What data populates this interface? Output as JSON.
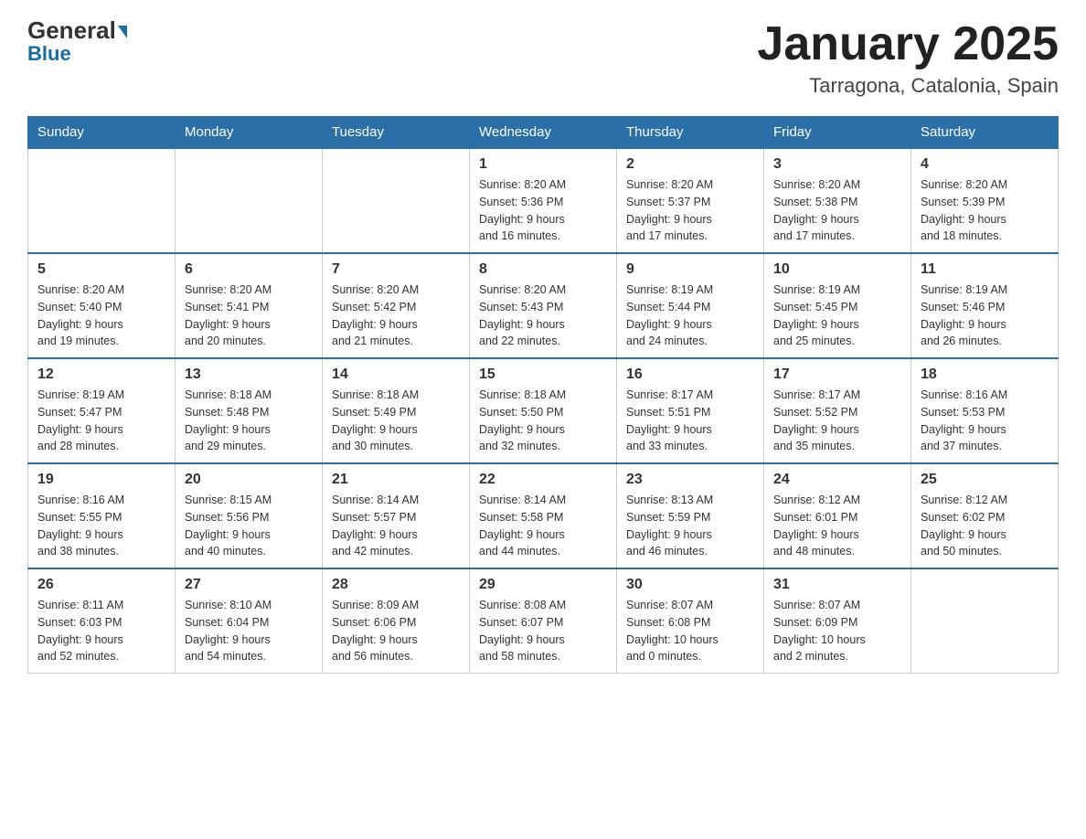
{
  "header": {
    "logo_general": "General",
    "logo_blue": "Blue",
    "month_title": "January 2025",
    "location": "Tarragona, Catalonia, Spain"
  },
  "days_of_week": [
    "Sunday",
    "Monday",
    "Tuesday",
    "Wednesday",
    "Thursday",
    "Friday",
    "Saturday"
  ],
  "weeks": [
    [
      {
        "day": "",
        "info": ""
      },
      {
        "day": "",
        "info": ""
      },
      {
        "day": "",
        "info": ""
      },
      {
        "day": "1",
        "info": "Sunrise: 8:20 AM\nSunset: 5:36 PM\nDaylight: 9 hours\nand 16 minutes."
      },
      {
        "day": "2",
        "info": "Sunrise: 8:20 AM\nSunset: 5:37 PM\nDaylight: 9 hours\nand 17 minutes."
      },
      {
        "day": "3",
        "info": "Sunrise: 8:20 AM\nSunset: 5:38 PM\nDaylight: 9 hours\nand 17 minutes."
      },
      {
        "day": "4",
        "info": "Sunrise: 8:20 AM\nSunset: 5:39 PM\nDaylight: 9 hours\nand 18 minutes."
      }
    ],
    [
      {
        "day": "5",
        "info": "Sunrise: 8:20 AM\nSunset: 5:40 PM\nDaylight: 9 hours\nand 19 minutes."
      },
      {
        "day": "6",
        "info": "Sunrise: 8:20 AM\nSunset: 5:41 PM\nDaylight: 9 hours\nand 20 minutes."
      },
      {
        "day": "7",
        "info": "Sunrise: 8:20 AM\nSunset: 5:42 PM\nDaylight: 9 hours\nand 21 minutes."
      },
      {
        "day": "8",
        "info": "Sunrise: 8:20 AM\nSunset: 5:43 PM\nDaylight: 9 hours\nand 22 minutes."
      },
      {
        "day": "9",
        "info": "Sunrise: 8:19 AM\nSunset: 5:44 PM\nDaylight: 9 hours\nand 24 minutes."
      },
      {
        "day": "10",
        "info": "Sunrise: 8:19 AM\nSunset: 5:45 PM\nDaylight: 9 hours\nand 25 minutes."
      },
      {
        "day": "11",
        "info": "Sunrise: 8:19 AM\nSunset: 5:46 PM\nDaylight: 9 hours\nand 26 minutes."
      }
    ],
    [
      {
        "day": "12",
        "info": "Sunrise: 8:19 AM\nSunset: 5:47 PM\nDaylight: 9 hours\nand 28 minutes."
      },
      {
        "day": "13",
        "info": "Sunrise: 8:18 AM\nSunset: 5:48 PM\nDaylight: 9 hours\nand 29 minutes."
      },
      {
        "day": "14",
        "info": "Sunrise: 8:18 AM\nSunset: 5:49 PM\nDaylight: 9 hours\nand 30 minutes."
      },
      {
        "day": "15",
        "info": "Sunrise: 8:18 AM\nSunset: 5:50 PM\nDaylight: 9 hours\nand 32 minutes."
      },
      {
        "day": "16",
        "info": "Sunrise: 8:17 AM\nSunset: 5:51 PM\nDaylight: 9 hours\nand 33 minutes."
      },
      {
        "day": "17",
        "info": "Sunrise: 8:17 AM\nSunset: 5:52 PM\nDaylight: 9 hours\nand 35 minutes."
      },
      {
        "day": "18",
        "info": "Sunrise: 8:16 AM\nSunset: 5:53 PM\nDaylight: 9 hours\nand 37 minutes."
      }
    ],
    [
      {
        "day": "19",
        "info": "Sunrise: 8:16 AM\nSunset: 5:55 PM\nDaylight: 9 hours\nand 38 minutes."
      },
      {
        "day": "20",
        "info": "Sunrise: 8:15 AM\nSunset: 5:56 PM\nDaylight: 9 hours\nand 40 minutes."
      },
      {
        "day": "21",
        "info": "Sunrise: 8:14 AM\nSunset: 5:57 PM\nDaylight: 9 hours\nand 42 minutes."
      },
      {
        "day": "22",
        "info": "Sunrise: 8:14 AM\nSunset: 5:58 PM\nDaylight: 9 hours\nand 44 minutes."
      },
      {
        "day": "23",
        "info": "Sunrise: 8:13 AM\nSunset: 5:59 PM\nDaylight: 9 hours\nand 46 minutes."
      },
      {
        "day": "24",
        "info": "Sunrise: 8:12 AM\nSunset: 6:01 PM\nDaylight: 9 hours\nand 48 minutes."
      },
      {
        "day": "25",
        "info": "Sunrise: 8:12 AM\nSunset: 6:02 PM\nDaylight: 9 hours\nand 50 minutes."
      }
    ],
    [
      {
        "day": "26",
        "info": "Sunrise: 8:11 AM\nSunset: 6:03 PM\nDaylight: 9 hours\nand 52 minutes."
      },
      {
        "day": "27",
        "info": "Sunrise: 8:10 AM\nSunset: 6:04 PM\nDaylight: 9 hours\nand 54 minutes."
      },
      {
        "day": "28",
        "info": "Sunrise: 8:09 AM\nSunset: 6:06 PM\nDaylight: 9 hours\nand 56 minutes."
      },
      {
        "day": "29",
        "info": "Sunrise: 8:08 AM\nSunset: 6:07 PM\nDaylight: 9 hours\nand 58 minutes."
      },
      {
        "day": "30",
        "info": "Sunrise: 8:07 AM\nSunset: 6:08 PM\nDaylight: 10 hours\nand 0 minutes."
      },
      {
        "day": "31",
        "info": "Sunrise: 8:07 AM\nSunset: 6:09 PM\nDaylight: 10 hours\nand 2 minutes."
      },
      {
        "day": "",
        "info": ""
      }
    ]
  ]
}
